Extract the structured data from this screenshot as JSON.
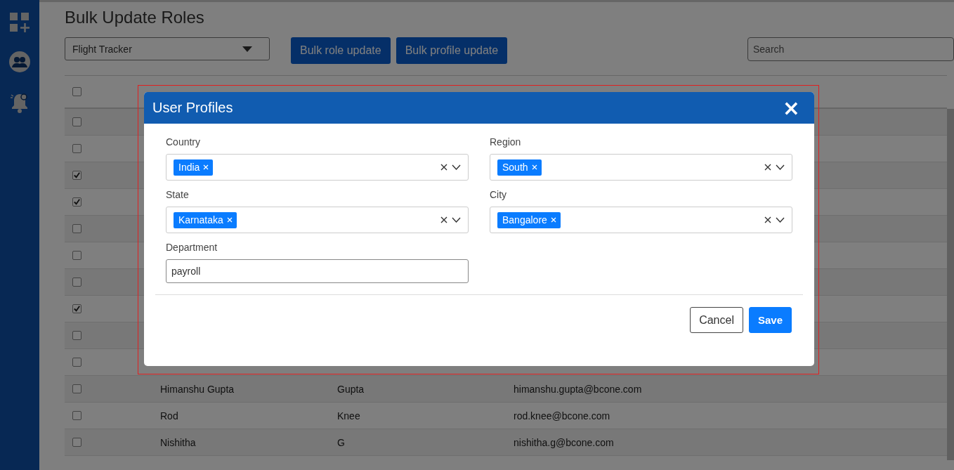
{
  "page_title": "Bulk Update Roles",
  "app_select": {
    "value": "Flight Tracker"
  },
  "toolbar_buttons": [
    "Bulk role update",
    "Bulk profile update"
  ],
  "search": {
    "placeholder": "Search"
  },
  "table": {
    "header_checked": false,
    "rows": [
      {
        "checked": false
      },
      {
        "checked": false
      },
      {
        "checked": true
      },
      {
        "checked": true
      },
      {
        "checked": false
      },
      {
        "checked": false
      },
      {
        "checked": false
      },
      {
        "checked": true
      },
      {
        "checked": false
      },
      {
        "checked": false
      },
      {
        "checked": false,
        "first_name": "Himanshu Gupta",
        "last_name": "Gupta",
        "email": "himanshu.gupta@bcone.com"
      },
      {
        "checked": false,
        "first_name": "Rod",
        "last_name": "Knee",
        "email": "rod.knee@bcone.com"
      },
      {
        "checked": false,
        "first_name": "Nishitha",
        "last_name": "G",
        "email": "nishitha.g@bcone.com"
      }
    ]
  },
  "modal": {
    "title": "User Profiles",
    "close": "×",
    "fields": [
      {
        "kind": "multiselect",
        "label": "Country",
        "tags": [
          "India"
        ]
      },
      {
        "kind": "multiselect",
        "label": "Region",
        "tags": [
          "South"
        ]
      },
      {
        "kind": "multiselect",
        "label": "State",
        "tags": [
          "Karnataka"
        ]
      },
      {
        "kind": "multiselect",
        "label": "City",
        "tags": [
          "Bangalore"
        ]
      },
      {
        "kind": "text",
        "label": "Department",
        "value": "payroll"
      }
    ],
    "buttons": [
      {
        "kind": "secondary",
        "label": "Cancel"
      },
      {
        "kind": "primary",
        "label": "Save"
      }
    ]
  }
}
